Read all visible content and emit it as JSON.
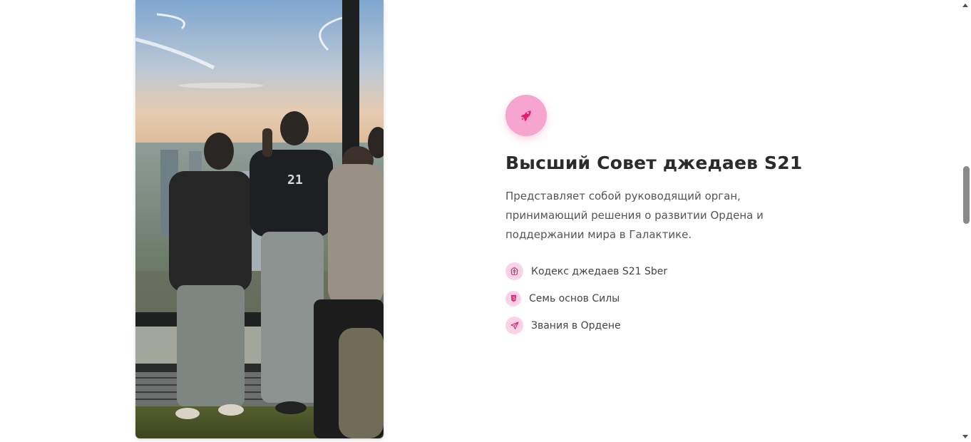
{
  "section": {
    "title": "Высший Совет джедаев S21",
    "description": "Представляет собой руководящий орган, принимающий решения о развитии Ордена и поддержании мира в Галактике.",
    "badge_icon": "rocket-icon",
    "items": [
      {
        "label": "Кодекс джедаев S21 Sber",
        "icon": "brain-icon"
      },
      {
        "label": "Семь основ Силы",
        "icon": "html5-icon"
      },
      {
        "label": "Звания в Ордене",
        "icon": "paper-plane-icon"
      }
    ]
  },
  "photo": {
    "shirt_print": "21"
  },
  "colors": {
    "accent": "#e11d74",
    "badge_bg": "#f6a5cf",
    "item_icon_bg": "#fbd3e7",
    "title": "#2b2b2b"
  }
}
